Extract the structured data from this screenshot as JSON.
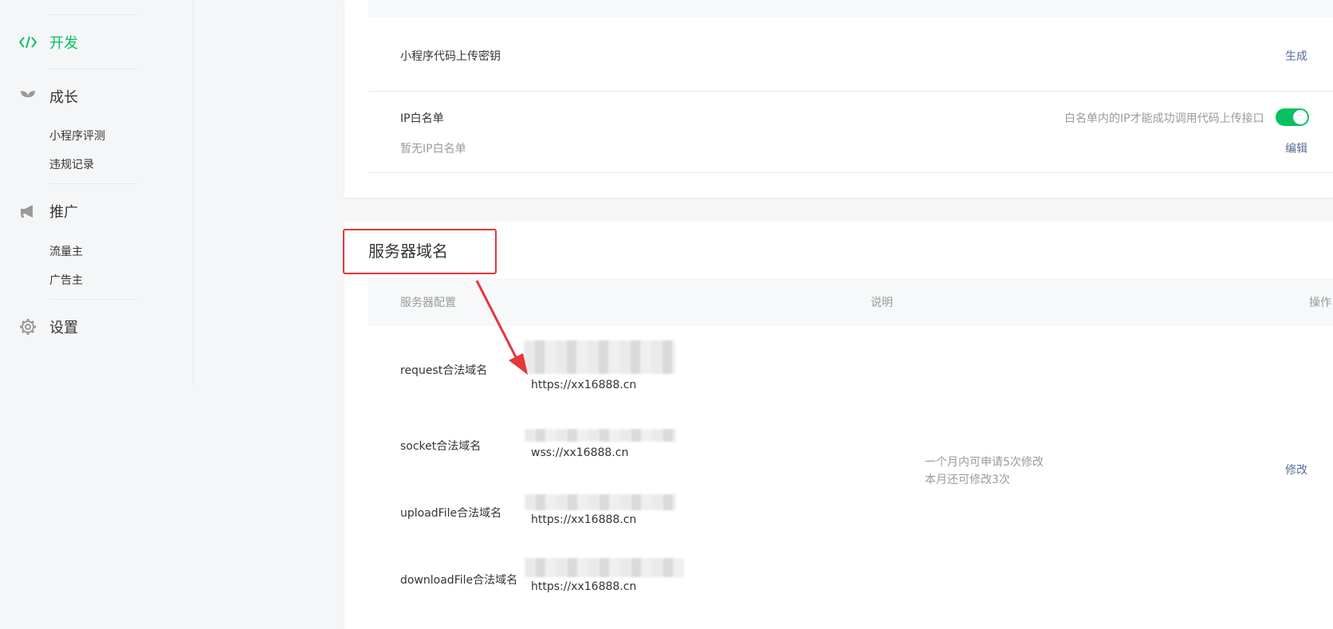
{
  "sidebar": {
    "groups": [
      {
        "label": "开发",
        "icon": "code-icon",
        "active": true
      },
      {
        "label": "成长",
        "icon": "sprout-icon",
        "active": false
      },
      {
        "label": "推广",
        "icon": "megaphone-icon",
        "active": false
      },
      {
        "label": "设置",
        "icon": "gear-icon",
        "active": false
      }
    ],
    "growth_items": [
      "小程序评测",
      "违规记录"
    ],
    "promo_items": [
      "流量主",
      "广告主"
    ]
  },
  "upload_key": {
    "label": "小程序代码上传密钥",
    "action": "生成"
  },
  "ip_whitelist": {
    "label": "IP白名单",
    "hint": "白名单内的IP才能成功调用代码上传接口",
    "empty": "暂无IP白名单",
    "action": "编辑",
    "enabled": true
  },
  "server_domain": {
    "title": "服务器域名",
    "headers": {
      "config": "服务器配置",
      "desc": "说明",
      "op": "操作"
    },
    "rows": [
      {
        "name": "request合法域名",
        "value": "https://xx16888.cn"
      },
      {
        "name": "socket合法域名",
        "value": "wss://xx16888.cn"
      },
      {
        "name": "uploadFile合法域名",
        "value": "https://xx16888.cn"
      },
      {
        "name": "downloadFile合法域名",
        "value": "https://xx16888.cn"
      }
    ],
    "desc_line1": "一个月内可申请5次修改",
    "desc_line2": "本月还可修改3次",
    "action": "修改"
  },
  "colors": {
    "accent": "#07c160",
    "link": "#576b95",
    "annotation": "#e8353a"
  }
}
